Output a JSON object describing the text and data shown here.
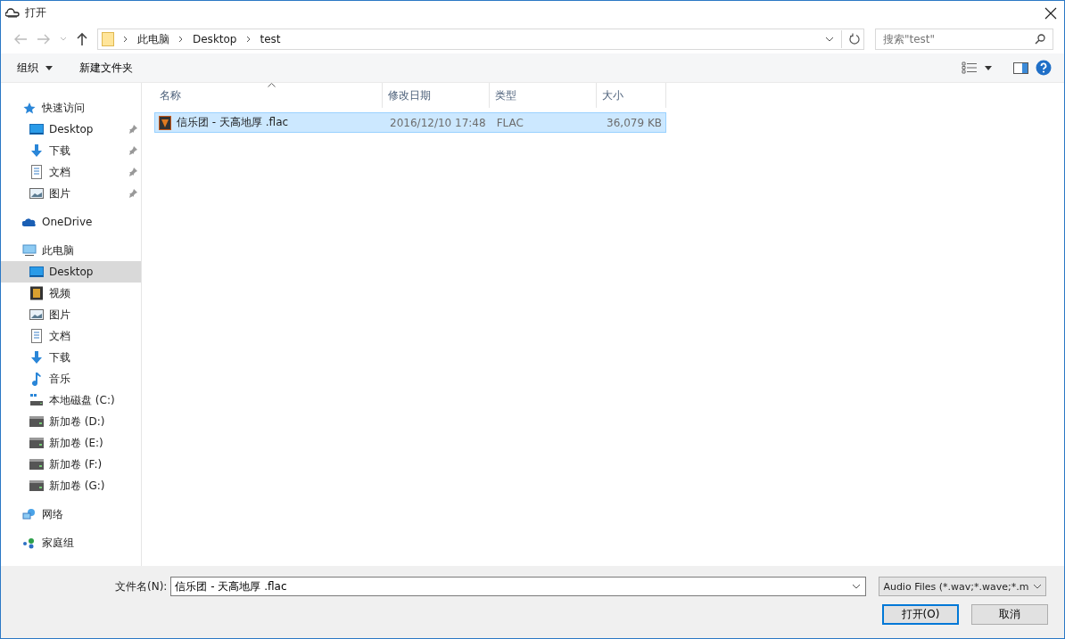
{
  "window": {
    "title": "打开"
  },
  "address": {
    "crumbs": [
      "此电脑",
      "Desktop",
      "test"
    ]
  },
  "search": {
    "placeholder": "搜索\"test\""
  },
  "toolbar": {
    "organize": "组织",
    "new_folder": "新建文件夹"
  },
  "sidebar": {
    "groups": [
      {
        "label": "快速访问",
        "kind": "star",
        "selected": false,
        "children": [
          {
            "label": "Desktop",
            "kind": "desktop",
            "selected": false,
            "pinned": true
          },
          {
            "label": "下载",
            "kind": "download",
            "selected": false,
            "pinned": true
          },
          {
            "label": "文档",
            "kind": "doc",
            "selected": false,
            "pinned": true
          },
          {
            "label": "图片",
            "kind": "picture",
            "selected": false,
            "pinned": true
          }
        ]
      },
      {
        "label": "OneDrive",
        "kind": "cloud",
        "selected": false
      },
      {
        "label": "此电脑",
        "kind": "pc",
        "selected": false,
        "children": [
          {
            "label": "Desktop",
            "kind": "desktop",
            "selected": true,
            "pinned": false
          },
          {
            "label": "视频",
            "kind": "video",
            "selected": false,
            "pinned": false
          },
          {
            "label": "图片",
            "kind": "picture",
            "selected": false,
            "pinned": false
          },
          {
            "label": "文档",
            "kind": "doc",
            "selected": false,
            "pinned": false
          },
          {
            "label": "下载",
            "kind": "download",
            "selected": false,
            "pinned": false
          },
          {
            "label": "音乐",
            "kind": "music",
            "selected": false,
            "pinned": false
          },
          {
            "label": "本地磁盘 (C:)",
            "kind": "sysdrive",
            "selected": false,
            "pinned": false
          },
          {
            "label": "新加卷 (D:)",
            "kind": "drive",
            "selected": false,
            "pinned": false
          },
          {
            "label": "新加卷 (E:)",
            "kind": "drive",
            "selected": false,
            "pinned": false
          },
          {
            "label": "新加卷 (F:)",
            "kind": "drive",
            "selected": false,
            "pinned": false
          },
          {
            "label": "新加卷 (G:)",
            "kind": "drive",
            "selected": false,
            "pinned": false
          }
        ]
      },
      {
        "label": "网络",
        "kind": "network",
        "selected": false
      },
      {
        "label": "家庭组",
        "kind": "homegroup",
        "selected": false
      }
    ]
  },
  "table": {
    "columns": [
      "名称",
      "修改日期",
      "类型",
      "大小"
    ],
    "rows": [
      {
        "name": "信乐团 - 天高地厚 .flac",
        "modified": "2016/12/10 17:48",
        "type": "FLAC",
        "size": "36,079 KB",
        "selected": true
      }
    ]
  },
  "footer": {
    "filename_label": "文件名(N):",
    "filename": "信乐团 - 天高地厚 .flac",
    "filter": "Audio Files (*.wav;*.wave;*.m",
    "open": "打开(O)",
    "cancel": "取消"
  }
}
